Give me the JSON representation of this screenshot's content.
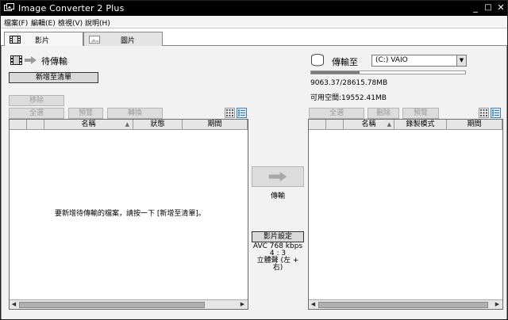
{
  "window": {
    "title": "Image Converter 2 Plus",
    "minimize": "_",
    "maximize": "□",
    "close": "✕"
  },
  "menu": [
    "檔案(F)",
    "編輯(E)",
    "檢視(V)",
    "說明(H)"
  ],
  "tabs": [
    {
      "label": "影片",
      "active": true,
      "icon": "film-icon"
    },
    {
      "label": "圖片",
      "active": false,
      "icon": "image-icon"
    }
  ],
  "left": {
    "header": "待傳輸",
    "add_to_list": "新增至清單",
    "remove": "移除",
    "select_all": "全選",
    "preview": "預覽",
    "convert": "轉換",
    "columns": [
      "名稱",
      "狀態",
      "期間"
    ],
    "empty_message": "要新增待傳輸的檔案，請按一下 [新增至清單]。"
  },
  "center": {
    "transfer_label": "傳輸",
    "video_settings": "影片設定",
    "codec": "AVC 768 kbps",
    "aspect": "4 : 3",
    "audio": "立體聲 (左 + 右)"
  },
  "right": {
    "header": "傳輸至",
    "device": "(C:) VAIO",
    "capacity": "9063.37/28615.78MB",
    "free_space": "可用空間:19552.41MB",
    "usage_fraction": 0.317,
    "select_all": "全選",
    "delete": "刪除",
    "preview": "預覽",
    "columns": [
      "名稱",
      "錄製模式",
      "期間"
    ]
  }
}
